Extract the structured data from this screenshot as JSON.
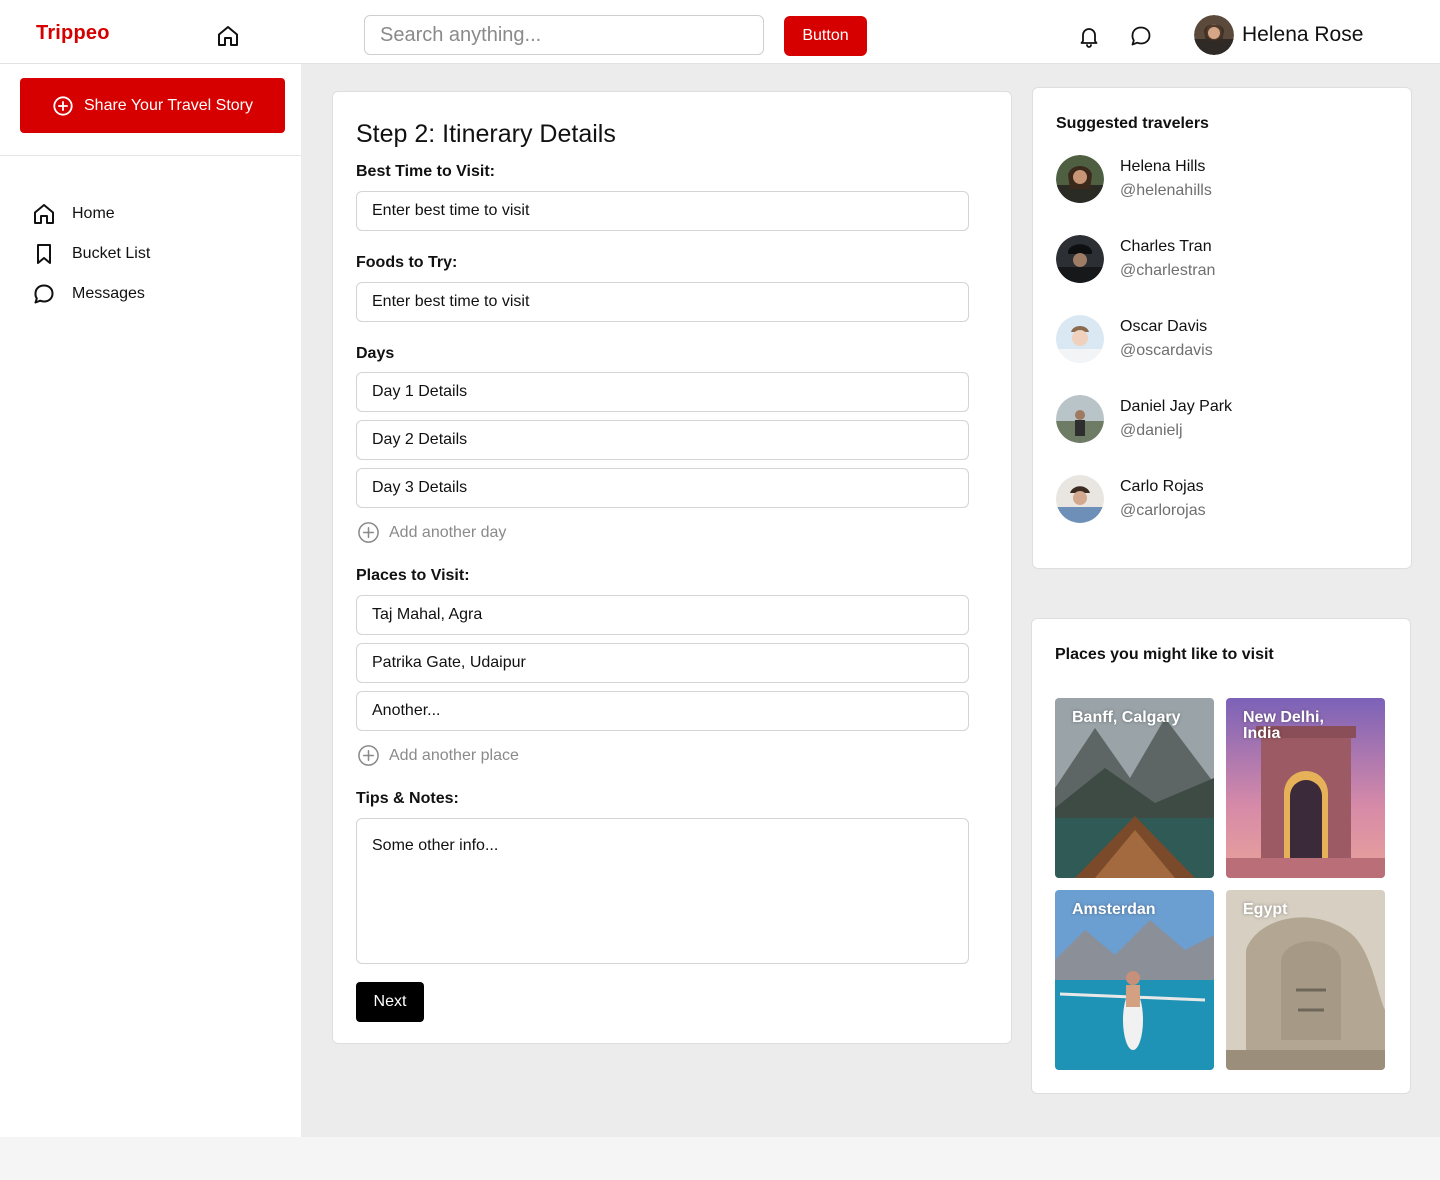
{
  "app": {
    "logo": "Trippeo"
  },
  "header": {
    "search_placeholder": "Search anything...",
    "button_label": "Button",
    "user_name": "Helena Rose"
  },
  "sidebar": {
    "share_label": "Share Your Travel Story",
    "items": [
      {
        "label": "Home",
        "icon": "home-icon"
      },
      {
        "label": "Bucket List",
        "icon": "bookmark-icon"
      },
      {
        "label": "Messages",
        "icon": "chat-icon"
      }
    ]
  },
  "form": {
    "title": "Step 2: Itinerary Details",
    "best_time_label": "Best Time to Visit:",
    "best_time_placeholder": "Enter best time to visit",
    "foods_label": "Foods to Try:",
    "foods_placeholder": "Enter best time to visit",
    "days_label": "Days",
    "days": [
      "Day 1 Details",
      "Day 2 Details",
      "Day 3 Details"
    ],
    "add_day": "Add another day",
    "places_label": "Places to Visit:",
    "places": [
      "Taj Mahal, Agra",
      "Patrika Gate, Udaipur",
      "Another..."
    ],
    "add_place": "Add another place",
    "tips_label": "Tips & Notes:",
    "tips_placeholder": "Some other info...",
    "next_label": "Next"
  },
  "suggested": {
    "title": "Suggested travelers",
    "travelers": [
      {
        "name": "Helena Hills",
        "handle": "@helenahills"
      },
      {
        "name": "Charles Tran",
        "handle": "@charlestran"
      },
      {
        "name": "Oscar Davis",
        "handle": "@oscardavis"
      },
      {
        "name": "Daniel Jay Park",
        "handle": "@danielj"
      },
      {
        "name": "Carlo Rojas",
        "handle": "@carlorojas"
      }
    ]
  },
  "places_card": {
    "title": "Places you might like to visit",
    "tiles": [
      {
        "caption": "Banff, Calgary"
      },
      {
        "caption": "New Delhi, India"
      },
      {
        "caption": "Amsterdan"
      },
      {
        "caption": "Egypt"
      }
    ]
  },
  "colors": {
    "brand": "#d60000",
    "text": "#111111",
    "muted": "#8a8a8a",
    "bg": "#ececec"
  }
}
